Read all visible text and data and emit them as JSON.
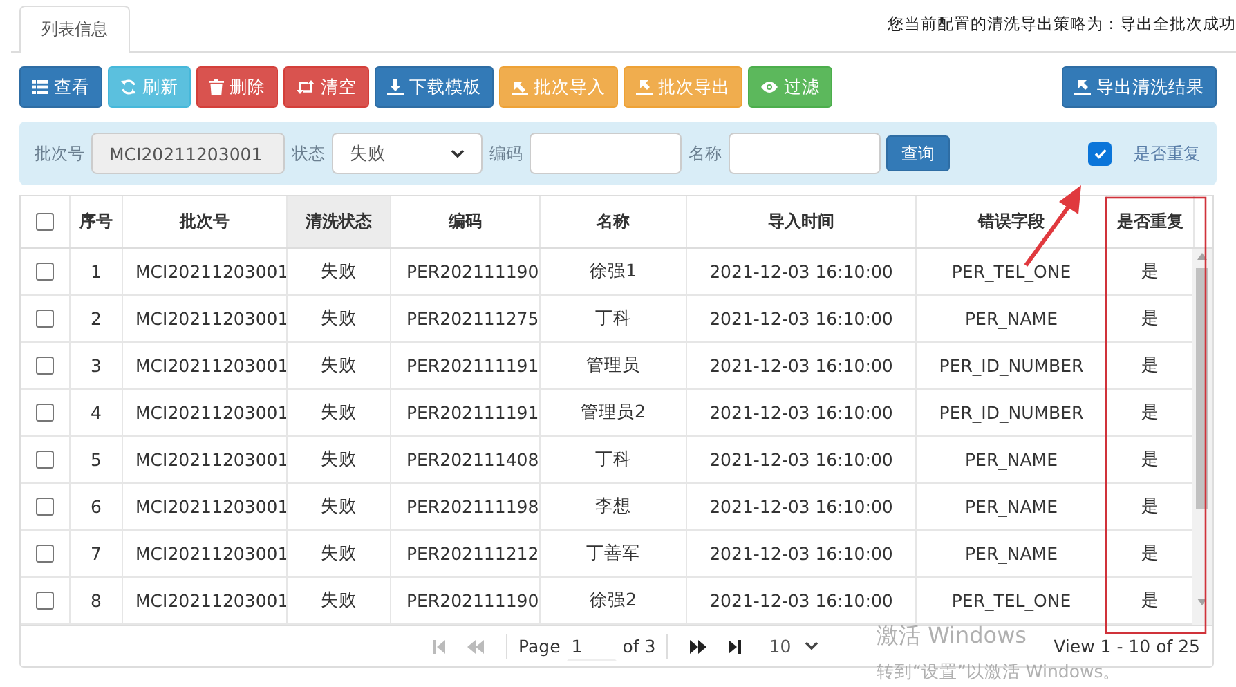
{
  "tabs": [
    {
      "label": "列表信息",
      "selected": true
    }
  ],
  "strategy_notice": "您当前配置的清洗导出策略为：导出全批次成功",
  "toolbar": [
    {
      "label": "查看",
      "kind": "primary"
    },
    {
      "label": "刷新",
      "kind": "info"
    },
    {
      "label": "删除",
      "kind": "danger"
    },
    {
      "label": "清空",
      "kind": "danger"
    },
    {
      "label": "下载模板",
      "kind": "primary"
    },
    {
      "label": "批次导入",
      "kind": "warning"
    },
    {
      "label": "批次导出",
      "kind": "warning"
    },
    {
      "label": "过滤",
      "kind": "success"
    }
  ],
  "export_button": {
    "label": "导出清洗结果",
    "kind": "primary"
  },
  "filter": {
    "batch_label": "批次号",
    "batch_value": "MCI20211203001",
    "batch_disabled": true,
    "status_label": "状态",
    "status_value": "失败",
    "code_label": "编码",
    "name_label": "名称",
    "query_button": "查询",
    "duplicate_checked": true,
    "duplicate_label": "是否重复"
  },
  "table": {
    "header_checked": false,
    "columns": [
      {
        "label": "序号",
        "highlighted": false
      },
      {
        "label": "批次号",
        "highlighted": false
      },
      {
        "label": "清洗状态",
        "highlighted": true
      },
      {
        "label": "编码",
        "highlighted": false
      },
      {
        "label": "名称",
        "highlighted": false
      },
      {
        "label": "导入时间",
        "highlighted": false
      },
      {
        "label": "错误字段",
        "highlighted": false
      },
      {
        "label": "是否重复",
        "highlighted": false
      }
    ],
    "rows": [
      {
        "checked": false,
        "cells": [
          "1",
          "MCI20211203001",
          "失败",
          "PER202111190",
          "徐强1",
          "2021-12-03 16:10:00",
          "PER_TEL_ONE",
          "是"
        ]
      },
      {
        "checked": false,
        "cells": [
          "2",
          "MCI20211203001",
          "失败",
          "PER202111275",
          "丁科",
          "2021-12-03 16:10:00",
          "PER_NAME",
          "是"
        ]
      },
      {
        "checked": false,
        "cells": [
          "3",
          "MCI20211203001",
          "失败",
          "PER202111191",
          "管理员",
          "2021-12-03 16:10:00",
          "PER_ID_NUMBER",
          "是"
        ]
      },
      {
        "checked": false,
        "cells": [
          "4",
          "MCI20211203001",
          "失败",
          "PER202111191",
          "管理员2",
          "2021-12-03 16:10:00",
          "PER_ID_NUMBER",
          "是"
        ]
      },
      {
        "checked": false,
        "cells": [
          "5",
          "MCI20211203001",
          "失败",
          "PER202111408",
          "丁科",
          "2021-12-03 16:10:00",
          "PER_NAME",
          "是"
        ]
      },
      {
        "checked": false,
        "cells": [
          "6",
          "MCI20211203001",
          "失败",
          "PER202111198",
          "李想",
          "2021-12-03 16:10:00",
          "PER_NAME",
          "是"
        ]
      },
      {
        "checked": false,
        "cells": [
          "7",
          "MCI20211203001",
          "失败",
          "PER202111212",
          "丁善军",
          "2021-12-03 16:10:00",
          "PER_NAME",
          "是"
        ]
      },
      {
        "checked": false,
        "cells": [
          "8",
          "MCI20211203001",
          "失败",
          "PER202111190",
          "徐强2",
          "2021-12-03 16:10:00",
          "PER_TEL_ONE",
          "是"
        ]
      }
    ]
  },
  "pager": {
    "back_disabled": true,
    "forward_disabled": false,
    "page_label": "Page",
    "page": "1",
    "page_count": "of 3",
    "page_size": "10",
    "view": "View 1 - 10 of 25"
  },
  "annotations": {
    "arrow": true,
    "column_box": true
  },
  "os_notice": {
    "title": "激活 Windows",
    "subtitle": "转到“设置”以激活 Windows。"
  }
}
